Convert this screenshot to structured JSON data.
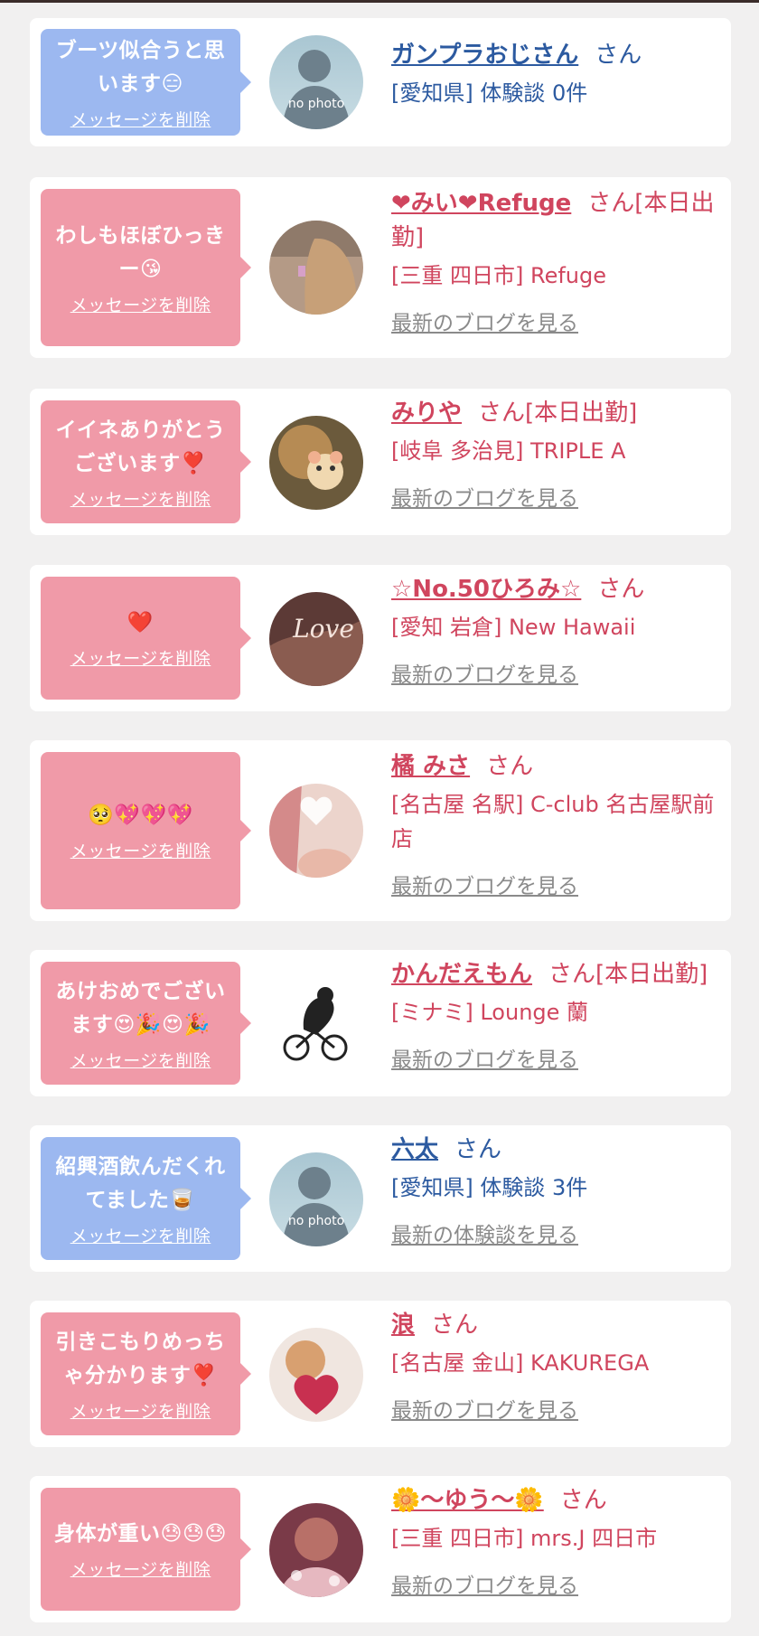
{
  "items": [
    {
      "message": "ブーツ似合うと思います😑",
      "delete_label": "メッセージを削除",
      "bubble_color": "#9cb8f0",
      "avatar": "no photo",
      "name": "ガンプラおじさん",
      "suffix": "さん",
      "location": "[愛知県] 体験談 0件",
      "link": "",
      "text_color": "#2c5aa0"
    },
    {
      "message": "わしもほぼひっきー😘",
      "delete_label": "メッセージを削除",
      "bubble_color": "#f09aa8",
      "avatar": "photo",
      "name": "❤みい❤Refuge",
      "suffix": "さん[本日出勤]",
      "location": "[三重 四日市] Refuge",
      "link": "最新のブログを見る",
      "text_color": "#d0455e"
    },
    {
      "message": "イイネありがとうございます❣️",
      "delete_label": "メッセージを削除",
      "bubble_color": "#f09aa8",
      "avatar": "photo",
      "name": "みりや",
      "suffix": "さん[本日出勤]",
      "location": "[岐阜 多治見] TRIPLE A",
      "link": "最新のブログを見る",
      "text_color": "#d0455e"
    },
    {
      "message": "❤️",
      "delete_label": "メッセージを削除",
      "bubble_color": "#f09aa8",
      "avatar": "photo",
      "name": "☆No.50ひろみ☆",
      "suffix": "さん",
      "location": "[愛知 岩倉] New Hawaii",
      "link": "最新のブログを見る",
      "text_color": "#d0455e"
    },
    {
      "message": "🥺💖💖💖",
      "delete_label": "メッセージを削除",
      "bubble_color": "#f09aa8",
      "avatar": "photo",
      "name": "橘 みさ",
      "suffix": "さん",
      "location": "[名古屋 名駅] C-club 名古屋駅前店",
      "link": "最新のブログを見る",
      "text_color": "#d0455e"
    },
    {
      "message": "あけおめでございます😍🎉😍🎉",
      "delete_label": "メッセージを削除",
      "bubble_color": "#f09aa8",
      "avatar": "bicycle",
      "name": "かんだえもん",
      "suffix": "さん[本日出勤]",
      "location": "[ミナミ] Lounge 蘭",
      "link": "最新のブログを見る",
      "text_color": "#d0455e"
    },
    {
      "message": "紹興酒飲んだくれてました🥃",
      "delete_label": "メッセージを削除",
      "bubble_color": "#9cb8f0",
      "avatar": "no photo",
      "name": "六太",
      "suffix": "さん",
      "location": "[愛知県] 体験談 3件",
      "link": "最新の体験談を見る",
      "text_color": "#2c5aa0"
    },
    {
      "message": "引きこもりめっちゃ分かります❣️",
      "delete_label": "メッセージを削除",
      "bubble_color": "#f09aa8",
      "avatar": "photo",
      "name": "浪",
      "suffix": "さん",
      "location": "[名古屋 金山] KAKUREGA",
      "link": "最新のブログを見る",
      "text_color": "#d0455e"
    },
    {
      "message": "身体が重い😓😓😓",
      "delete_label": "メッセージを削除",
      "bubble_color": "#f09aa8",
      "avatar": "photo",
      "name": "🌼〜ゆう〜🌼",
      "suffix": "さん",
      "location": "[三重 四日市] mrs.J 四日市",
      "link": "最新のブログを見る",
      "text_color": "#d0455e"
    }
  ]
}
